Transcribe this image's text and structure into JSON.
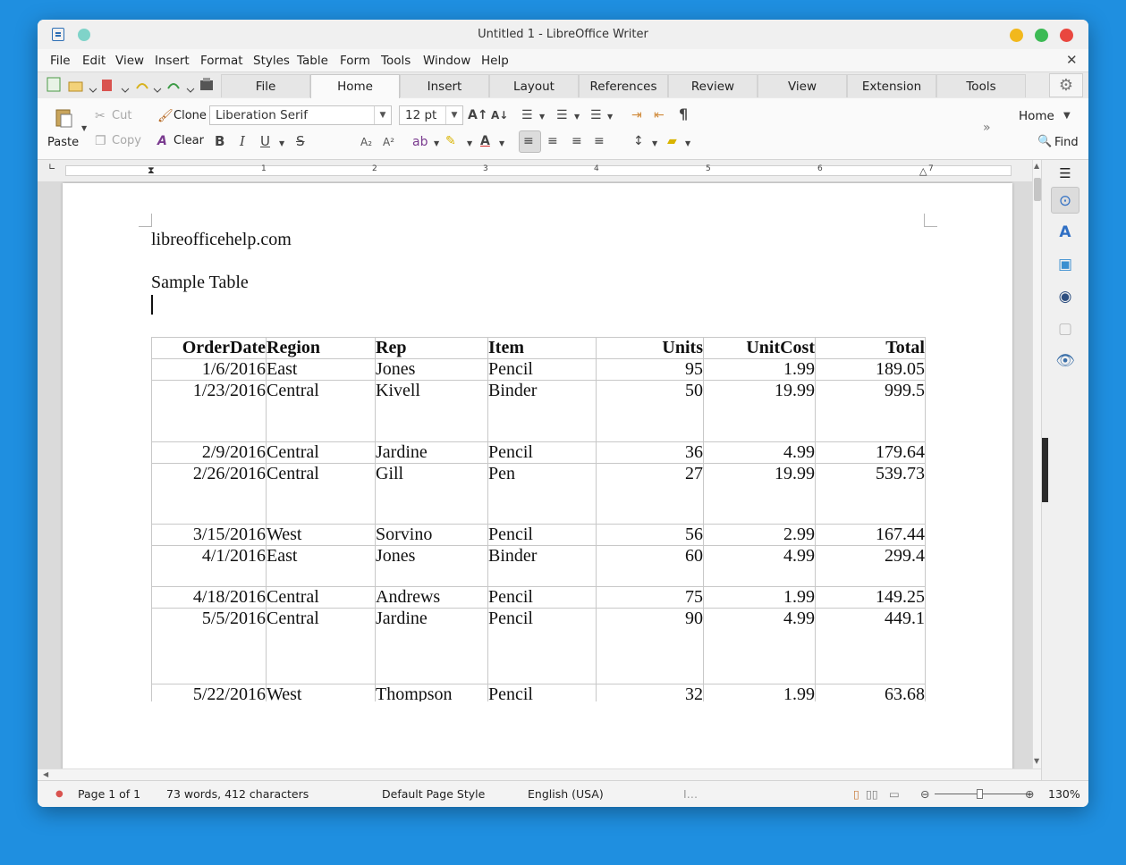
{
  "window": {
    "title": "Untitled 1 - LibreOffice Writer"
  },
  "menu": [
    "File",
    "Edit",
    "View",
    "Insert",
    "Format",
    "Styles",
    "Table",
    "Form",
    "Tools",
    "Window",
    "Help"
  ],
  "tabs": [
    "File",
    "Home",
    "Insert",
    "Layout",
    "References",
    "Review",
    "View",
    "Extension",
    "Tools"
  ],
  "active_tab": "Home",
  "ribbon": {
    "paste": "Paste",
    "cut": "Cut",
    "copy": "Copy",
    "clone": "Clone",
    "clear": "Clear",
    "font_name": "Liberation Serif",
    "font_size": "12 pt",
    "home_dropdown": "Home",
    "find": "Find",
    "bold": "B",
    "italic": "I",
    "underline": "U",
    "strike": "S",
    "pilcrow": "¶"
  },
  "ruler": {
    "numbers": [
      "1",
      "2",
      "3",
      "4",
      "5",
      "6",
      "7"
    ]
  },
  "document": {
    "line1": "libreofficehelp.com",
    "line2": "Sample Table",
    "table": {
      "headers": [
        "OrderDate",
        "Region",
        "Rep",
        "Item",
        "Units",
        "UnitCost",
        "Total"
      ],
      "rows": [
        [
          "1/6/2016",
          "East",
          "Jones",
          "Pencil",
          "95",
          "1.99",
          "189.05"
        ],
        [
          "1/23/2016",
          "Central",
          "Kivell",
          "Binder",
          "50",
          "19.99",
          "999.5"
        ],
        [
          "2/9/2016",
          "Central",
          "Jardine",
          "Pencil",
          "36",
          "4.99",
          "179.64"
        ],
        [
          "2/26/2016",
          "Central",
          "Gill",
          "Pen",
          "27",
          "19.99",
          "539.73"
        ],
        [
          "3/15/2016",
          "West",
          "Sorvino",
          "Pencil",
          "56",
          "2.99",
          "167.44"
        ],
        [
          "4/1/2016",
          "East",
          "Jones",
          "Binder",
          "60",
          "4.99",
          "299.4"
        ],
        [
          "4/18/2016",
          "Central",
          "Andrews",
          "Pencil",
          "75",
          "1.99",
          "149.25"
        ],
        [
          "5/5/2016",
          "Central",
          "Jardine",
          "Pencil",
          "90",
          "4.99",
          "449.1"
        ],
        [
          "5/22/2016",
          "West",
          "Thompson",
          "Pencil",
          "32",
          "1.99",
          "63.68"
        ]
      ]
    }
  },
  "status": {
    "page": "Page 1 of 1",
    "words": "73 words, 412 characters",
    "page_style": "Default Page Style",
    "language": "English (USA)",
    "zoom": "130%"
  }
}
